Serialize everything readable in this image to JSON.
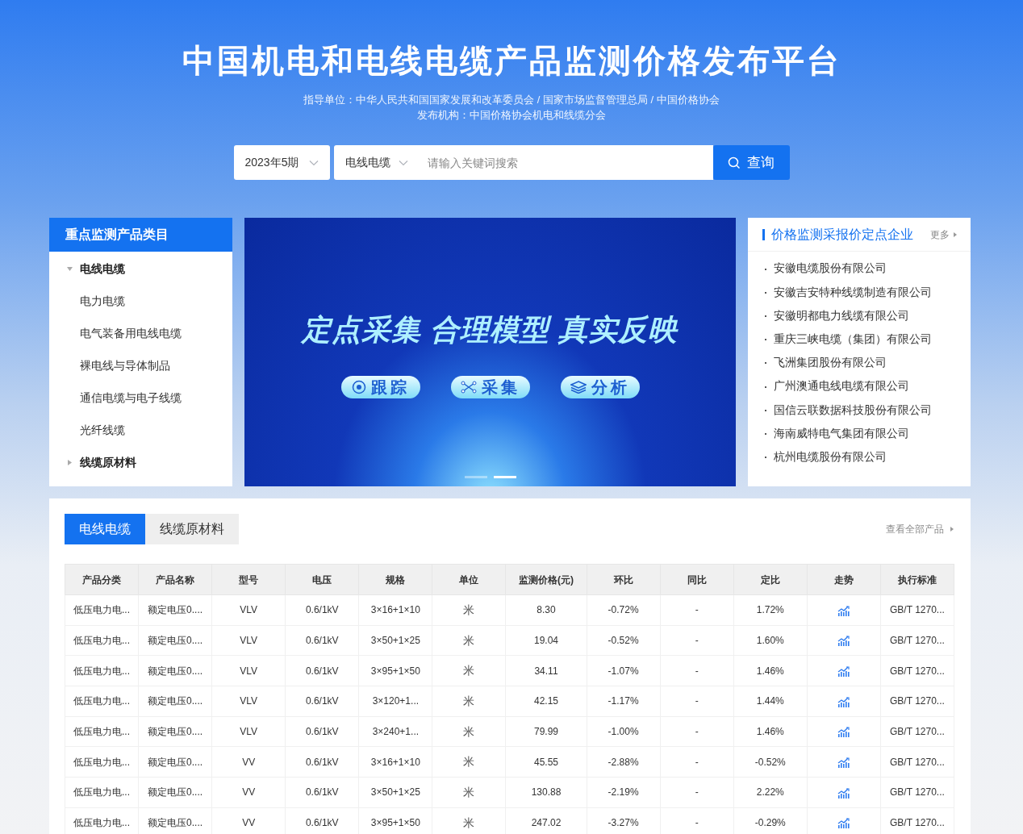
{
  "header": {
    "title": "中国机电和电线电缆产品监测价格发布平台",
    "guide": "指导单位：中华人民共和国国家发展和改革委员会 / 国家市场监督管理总局 / 中国价格协会",
    "publisher": "发布机构：中国价格协会机电和线缆分会"
  },
  "search": {
    "period": "2023年5期",
    "category": "电线电缆",
    "placeholder": "请输入关键词搜索",
    "button": "查询"
  },
  "sidebar": {
    "title": "重点监测产品类目",
    "items": [
      {
        "label": "电线电缆",
        "expanded": true,
        "children": [
          {
            "label": "电力电缆"
          },
          {
            "label": "电气装备用电线电缆"
          },
          {
            "label": "裸电线与导体制品"
          },
          {
            "label": "通信电缆与电子线缆"
          },
          {
            "label": "光纤线缆"
          }
        ]
      },
      {
        "label": "线缆原材料",
        "expanded": false
      }
    ]
  },
  "banner": {
    "headline": "定点采集 合理模型 真实反映",
    "pills": [
      {
        "label": "跟踪",
        "kind": "track"
      },
      {
        "label": "采集",
        "kind": "collect"
      },
      {
        "label": "分析",
        "kind": "analyze"
      }
    ],
    "dots": [
      {
        "selected": false
      },
      {
        "selected": true
      }
    ]
  },
  "companies": {
    "title": "价格监测采报价定点企业",
    "more": "更多",
    "items": [
      "安徽电缆股份有限公司",
      "安徽吉安特种线缆制造有限公司",
      "安徽明都电力线缆有限公司",
      "重庆三峡电缆（集团）有限公司",
      "飞洲集团股份有限公司",
      "广州澳通电线电缆有限公司",
      "国信云联数据科技股份有限公司",
      "海南威特电气集团有限公司",
      "杭州电缆股份有限公司"
    ]
  },
  "products": {
    "tabs": [
      {
        "label": "电线电缆",
        "selected": true
      },
      {
        "label": "线缆原材料",
        "selected": false
      }
    ],
    "view_all": "查看全部产品",
    "columns": [
      "产品分类",
      "产品名称",
      "型号",
      "电压",
      "规格",
      "单位",
      "监测价格(元)",
      "环比",
      "同比",
      "定比",
      "走势",
      "执行标准"
    ],
    "rows": [
      [
        "低压电力电...",
        "额定电压0....",
        "VLV",
        "0.6/1kV",
        "3×16+1×10",
        "米",
        "8.30",
        "-0.72%",
        "-",
        "1.72%",
        "GB/T 1270..."
      ],
      [
        "低压电力电...",
        "额定电压0....",
        "VLV",
        "0.6/1kV",
        "3×50+1×25",
        "米",
        "19.04",
        "-0.52%",
        "-",
        "1.60%",
        "GB/T 1270..."
      ],
      [
        "低压电力电...",
        "额定电压0....",
        "VLV",
        "0.6/1kV",
        "3×95+1×50",
        "米",
        "34.11",
        "-1.07%",
        "-",
        "1.46%",
        "GB/T 1270..."
      ],
      [
        "低压电力电...",
        "额定电压0....",
        "VLV",
        "0.6/1kV",
        "3×120+1...",
        "米",
        "42.15",
        "-1.17%",
        "-",
        "1.44%",
        "GB/T 1270..."
      ],
      [
        "低压电力电...",
        "额定电压0....",
        "VLV",
        "0.6/1kV",
        "3×240+1...",
        "米",
        "79.99",
        "-1.00%",
        "-",
        "1.46%",
        "GB/T 1270..."
      ],
      [
        "低压电力电...",
        "额定电压0....",
        "VV",
        "0.6/1kV",
        "3×16+1×10",
        "米",
        "45.55",
        "-2.88%",
        "-",
        "-0.52%",
        "GB/T 1270..."
      ],
      [
        "低压电力电...",
        "额定电压0....",
        "VV",
        "0.6/1kV",
        "3×50+1×25",
        "米",
        "130.88",
        "-2.19%",
        "-",
        "2.22%",
        "GB/T 1270..."
      ],
      [
        "低压电力电...",
        "额定电压0....",
        "VV",
        "0.6/1kV",
        "3×95+1×50",
        "米",
        "247.02",
        "-3.27%",
        "-",
        "-0.29%",
        "GB/T 1270..."
      ]
    ]
  }
}
